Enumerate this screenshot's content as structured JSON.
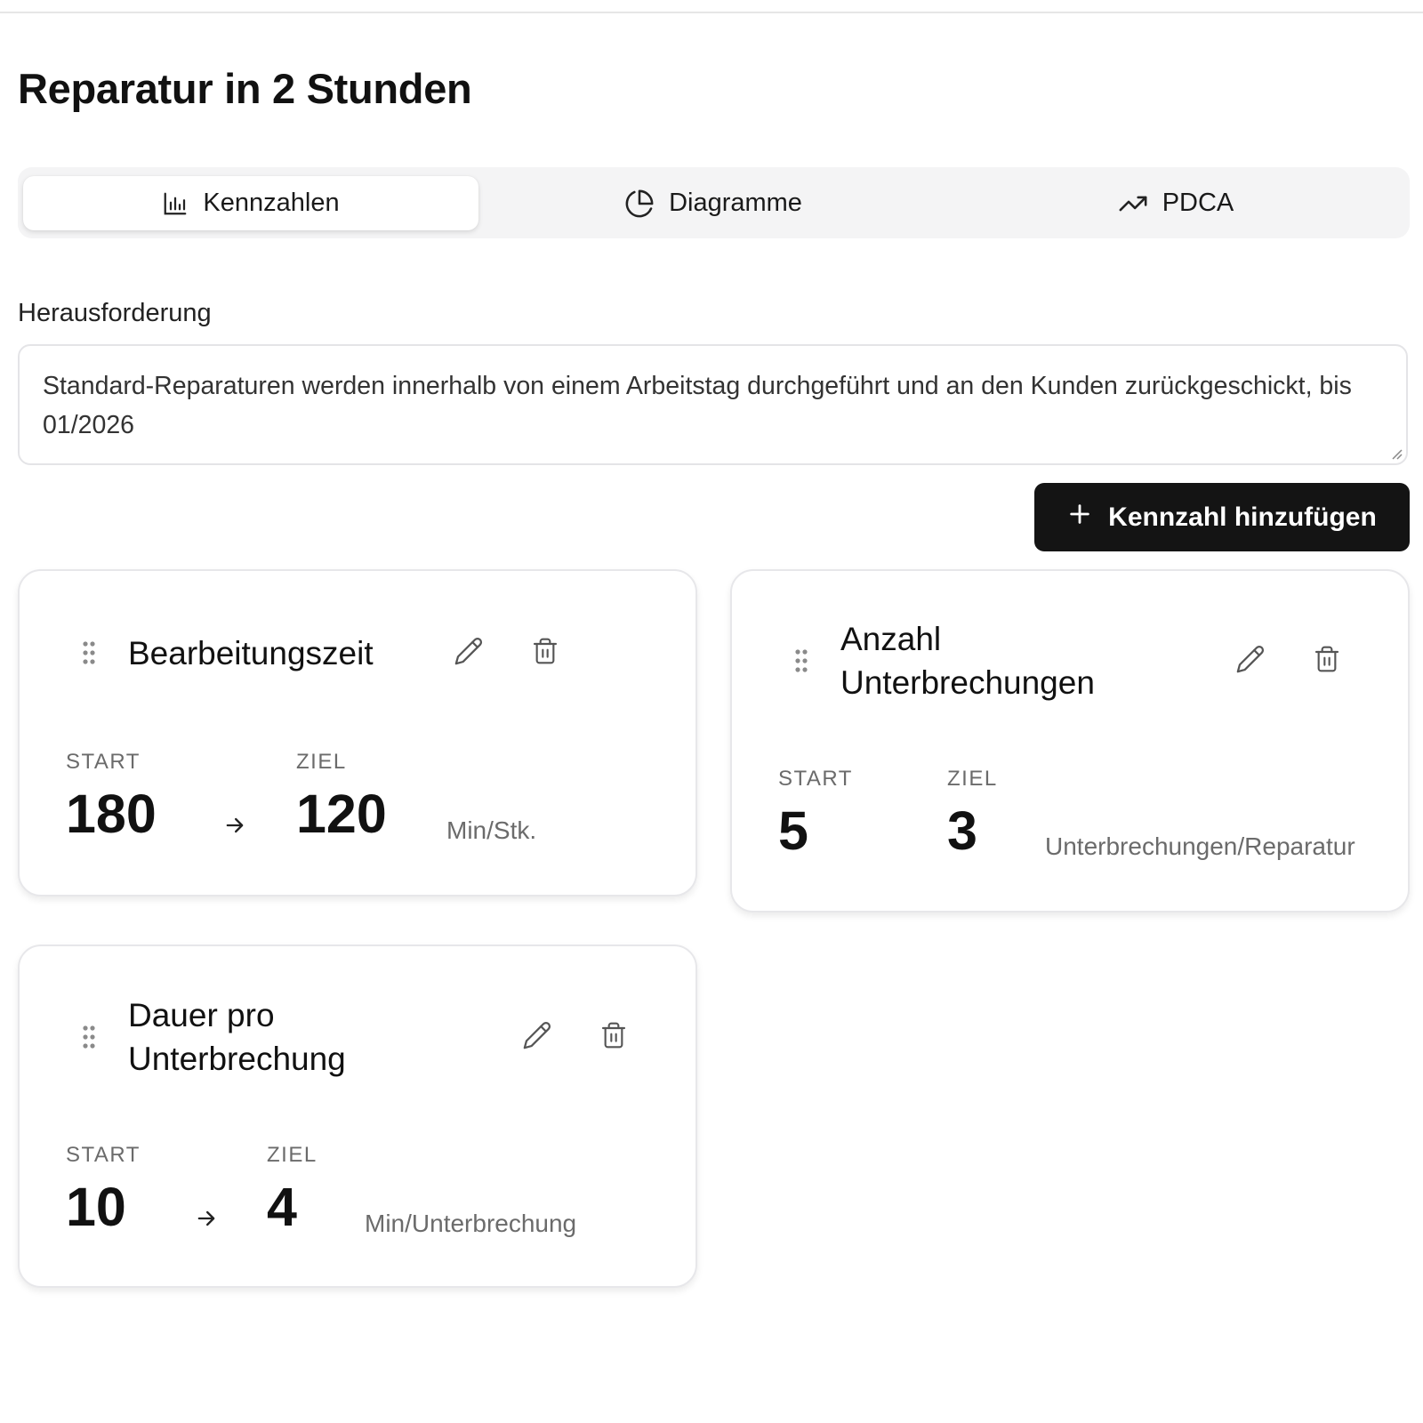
{
  "page": {
    "title": "Reparatur in 2 Stunden"
  },
  "tabs": [
    {
      "label": "Kennzahlen",
      "icon": "bar-chart-icon",
      "active": true
    },
    {
      "label": "Diagramme",
      "icon": "pie-chart-icon",
      "active": false
    },
    {
      "label": "PDCA",
      "icon": "trending-up-icon",
      "active": false
    }
  ],
  "challenge": {
    "label": "Herausforderung",
    "value": "Standard-Reparaturen werden innerhalb von einem Arbeitstag durchgeführt und an den Kunden zurückgeschickt, bis 01/2026"
  },
  "add_button": {
    "label": "Kennzahl hinzufügen",
    "icon": "plus-icon"
  },
  "metrics": [
    {
      "title": "Bearbeitungszeit",
      "start_label": "START",
      "start": "180",
      "target_label": "ZIEL",
      "target": "120",
      "unit": "Min/Stk."
    },
    {
      "title": "Anzahl Unterbrechungen",
      "start_label": "START",
      "start": "5",
      "target_label": "ZIEL",
      "target": "3",
      "unit": "Unterbrechungen/Reparatur"
    },
    {
      "title": "Dauer pro Unterbrechung",
      "start_label": "START",
      "start": "10",
      "target_label": "ZIEL",
      "target": "4",
      "unit": "Min/Unterbrechung"
    }
  ],
  "colors": {
    "accent_dark": "#141414",
    "tab_bar_bg": "#f4f4f5",
    "muted_text": "#6b6b6b",
    "border": "#e7e7ea"
  }
}
